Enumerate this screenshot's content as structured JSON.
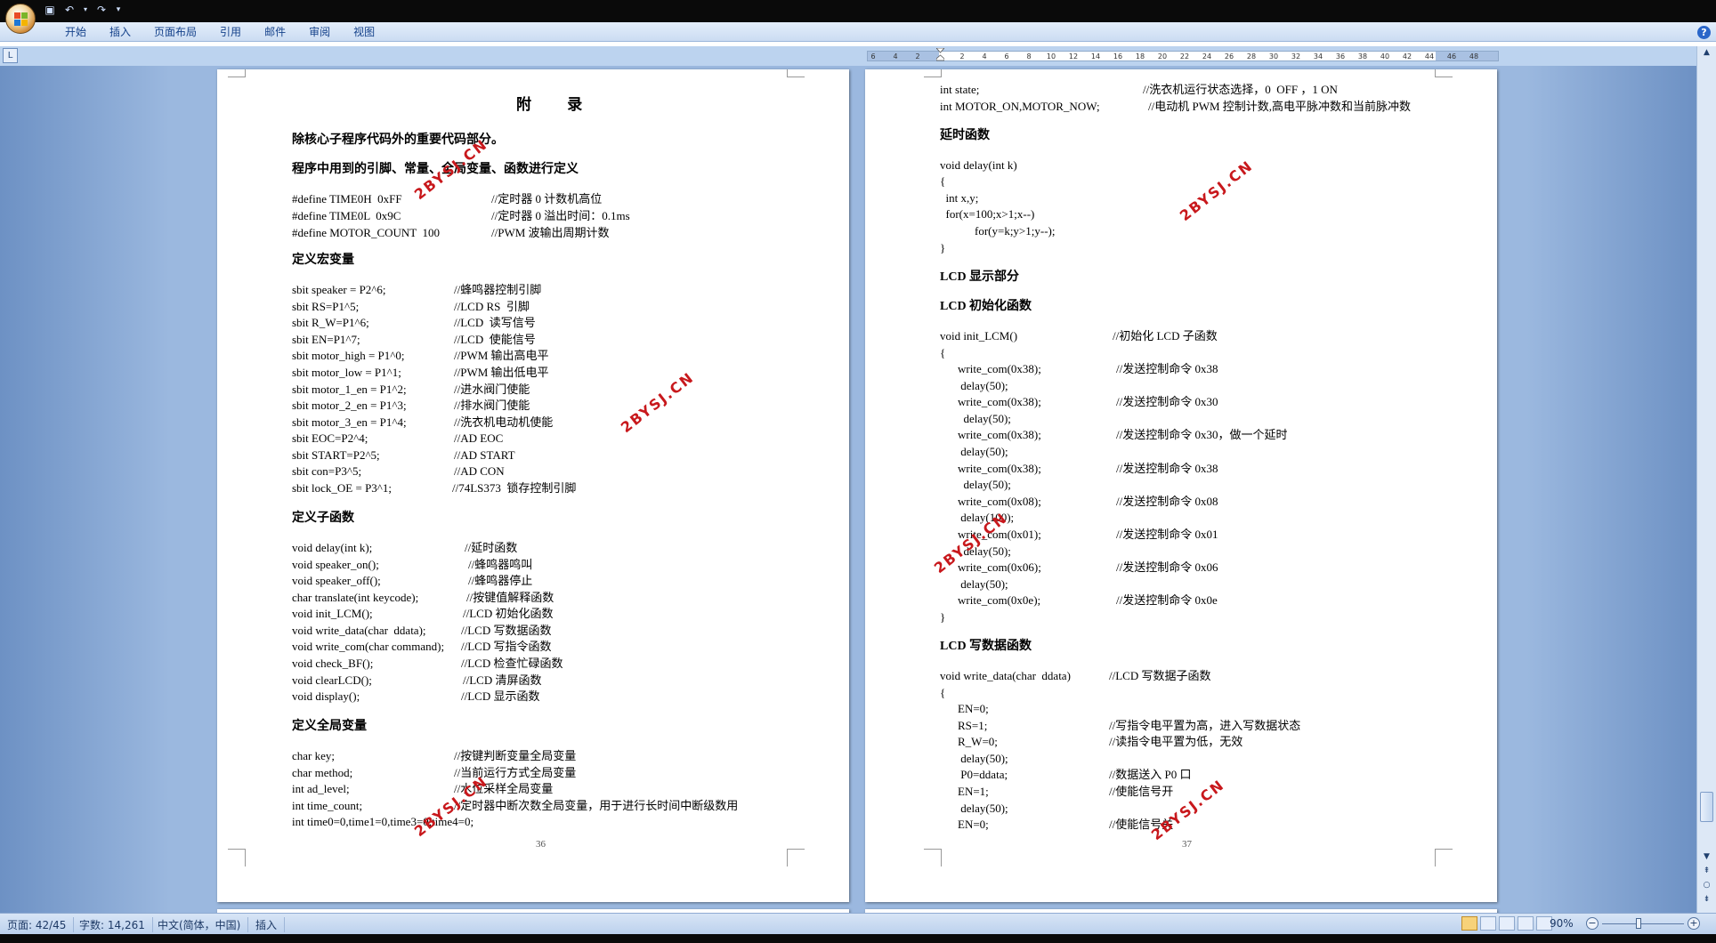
{
  "ribbon": {
    "tabs": [
      "开始",
      "插入",
      "页面布局",
      "引用",
      "邮件",
      "审阅",
      "视图"
    ]
  },
  "ruler": {
    "ticks": [
      "6",
      "4",
      "2",
      "2",
      "4",
      "6",
      "8",
      "10",
      "12",
      "14",
      "16",
      "18",
      "20",
      "22",
      "24",
      "26",
      "28",
      "30",
      "32",
      "34",
      "36",
      "38",
      "40",
      "42",
      "44",
      "46",
      "48"
    ]
  },
  "watermark": "2BYSJ.CN",
  "left_page": {
    "title": "附  录",
    "intro": "除核心子程序代码外的重要代码部分。",
    "section1": "程序中用到的引脚、常量、全局变量、函数进行定义",
    "defines": [
      [
        "#define TIME0H  0xFF",
        "//定时器 0 计数机高位"
      ],
      [
        "#define TIME0L  0x9C",
        "//定时器 0 溢出时间：0.1ms"
      ],
      [
        "#define MOTOR_COUNT  100",
        "//PWM 波输出周期计数"
      ]
    ],
    "section2": "定义宏变量",
    "sbits": [
      [
        "sbit speaker = P2^6;",
        "//蜂鸣器控制引脚"
      ],
      [
        "sbit RS=P1^5;",
        "//LCD RS  引脚"
      ],
      [
        "sbit R_W=P1^6;",
        "//LCD  读写信号"
      ],
      [
        "sbit EN=P1^7;",
        "//LCD  使能信号"
      ],
      [
        "sbit motor_high = P1^0;",
        "//PWM 输出高电平"
      ],
      [
        "sbit motor_low = P1^1;",
        "//PWM 输出低电平"
      ],
      [
        "sbit motor_1_en = P1^2;",
        "//进水阀门使能"
      ],
      [
        "sbit motor_2_en = P1^3;",
        "//排水阀门使能"
      ],
      [
        "sbit motor_3_en = P1^4;",
        "//洗衣机电动机使能"
      ],
      [
        "sbit EOC=P2^4;",
        "//AD EOC"
      ],
      [
        "sbit START=P2^5;",
        "//AD START"
      ],
      [
        "sbit con=P3^5;",
        "//AD CON"
      ],
      [
        "sbit lock_OE = P3^1;",
        "//74LS373  锁存控制引脚"
      ]
    ],
    "section3": "定义子函数",
    "funcs": [
      [
        "void delay(int k);",
        "//延时函数"
      ],
      [
        "void speaker_on();",
        "//蜂鸣器鸣叫"
      ],
      [
        "void speaker_off();",
        "//蜂鸣器停止"
      ],
      [
        "char translate(int keycode);",
        "//按键值解释函数"
      ],
      [
        "void init_LCM();",
        "//LCD 初始化函数"
      ],
      [
        "void write_data(char  ddata);",
        "//LCD 写数据函数"
      ],
      [
        "void write_com(char command);",
        "//LCD 写指令函数"
      ],
      [
        "void check_BF();",
        "//LCD 检查忙碌函数"
      ],
      [
        "void clearLCD();",
        "//LCD 清屏函数"
      ],
      [
        "void display();",
        "//LCD 显示函数"
      ]
    ],
    "section4": "定义全局变量",
    "globals": [
      [
        "char key;",
        "//按键判断变量全局变量"
      ],
      [
        "char method;",
        "//当前运行方式全局变量"
      ],
      [
        "int ad_level;",
        "//水位采样全局变量"
      ],
      [
        "int time_count;",
        "//定时器中断次数全局变量，用于进行长时间中断级数用"
      ],
      [
        "int time0=0,time1=0,time3=0,time4=0;",
        ""
      ]
    ],
    "page_number": "36"
  },
  "right_page": {
    "top_lines": [
      [
        "int state;",
        "//洗衣机运行状态选择，0  OFF ，1 ON"
      ],
      [
        "int MOTOR_ON,MOTOR_NOW;",
        "//电动机 PWM 控制计数,高电平脉冲数和当前脉冲数"
      ]
    ],
    "section1": "延时函数",
    "delay_code": [
      "void delay(int k)",
      "{",
      "  int x,y;",
      "  for(x=100;x>1;x--)",
      "            for(y=k;y>1;y--);",
      "}"
    ],
    "section2": "LCD 显示部分",
    "section3": "LCD 初始化函数",
    "init_header": [
      "void init_LCM()",
      "//初始化 LCD 子函数"
    ],
    "init_open": "{",
    "init_lines": [
      [
        "write_com(0x38);",
        "//发送控制命令 0x38"
      ],
      [
        " delay(50);",
        ""
      ],
      [
        "write_com(0x38);",
        "//发送控制命令 0x30"
      ],
      [
        "  delay(50);",
        ""
      ],
      [
        "write_com(0x38);",
        "//发送控制命令 0x30，做一个延时"
      ],
      [
        " delay(50);",
        ""
      ],
      [
        "write_com(0x38);",
        "//发送控制命令 0x38"
      ],
      [
        "  delay(50);",
        ""
      ],
      [
        "write_com(0x08);",
        "//发送控制命令 0x08"
      ],
      [
        " delay(100);",
        ""
      ],
      [
        "write_com(0x01);",
        "//发送控制命令 0x01"
      ],
      [
        "  delay(50);",
        ""
      ],
      [
        "write_com(0x06);",
        "//发送控制命令 0x06"
      ],
      [
        " delay(50);",
        ""
      ],
      [
        "write_com(0x0e);",
        "//发送控制命令 0x0e"
      ]
    ],
    "init_close": "}",
    "section4": "LCD 写数据函数",
    "wd_header": [
      "void write_data(char  ddata)",
      "//LCD 写数据子函数"
    ],
    "wd_open": "{",
    "wd_lines": [
      [
        "EN=0;",
        ""
      ],
      [
        "RS=1;",
        "//写指令电平置为高，进入写数据状态"
      ],
      [
        "R_W=0;",
        "//读指令电平置为低，无效"
      ],
      [
        " delay(50);",
        ""
      ],
      [
        " P0=ddata;",
        "//数据送入 P0 口"
      ],
      [
        "EN=1;",
        "//使能信号开"
      ],
      [
        " delay(50);",
        ""
      ],
      [
        "EN=0;",
        "//使能信号关"
      ]
    ],
    "page_number": "37"
  },
  "status": {
    "page": "页面: 42/45",
    "words": "字数: 14,261",
    "lang": "中文(简体，中国)",
    "mode": "插入",
    "zoom": "90%"
  }
}
